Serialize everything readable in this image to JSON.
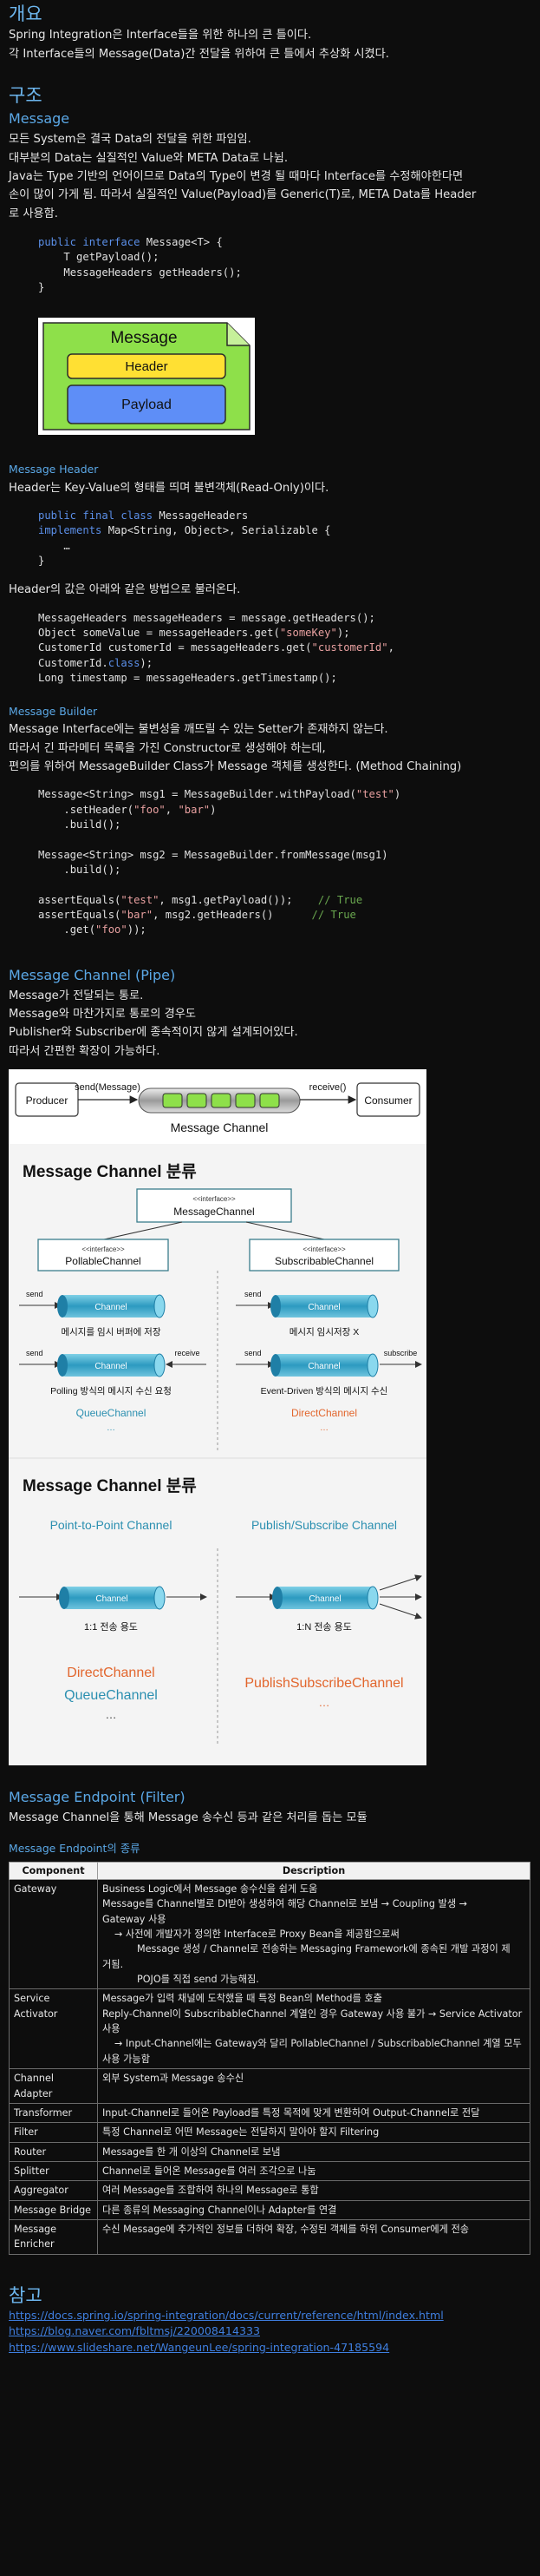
{
  "overview": {
    "title": "개요",
    "lines": [
      "Spring Integration은 Interface들을 위한 하나의 큰 틀이다.",
      "각 Interface들의 Message(Data)간 전달을 위하여 큰 틀에서 추상화 시켰다."
    ]
  },
  "structure": {
    "title": "구조",
    "message": {
      "title": "Message",
      "lines": [
        "모든 System은 결국 Data의 전달을 위한 파임임.",
        "대부분의 Data는 실질적인 Value와 META Data로 나뉨.",
        "Java는 Type 기반의 언어이므로 Data의 Type이 변경 될 때마다 Interface를 수정해야한다면",
        "손이 많이 가게 됨. 따라서 실질적인 Value(Payload)를 Generic(T)로, META Data를 Header",
        "로 사용함."
      ],
      "code": {
        "kw_public": "public",
        "kw_interface": "interface",
        "line1_rest": " Message<T> {",
        "line2": "T getPayload();",
        "line3": "MessageHeaders getHeaders();",
        "line4": "}"
      },
      "diagram": {
        "title": "Message",
        "header": "Header",
        "payload": "Payload",
        "colors": {
          "outer": "#8ee04a",
          "header": "#ffe033",
          "payload": "#5e8ef7"
        }
      }
    },
    "header": {
      "title": "Message Header",
      "line": "Header는 Key-Value의 형태를 띄며 불변객체(Read-Only)이다.",
      "code": {
        "kw_public": "public",
        "kw_final": "final",
        "kw_class": "class",
        "l1_rest": " MessageHeaders",
        "kw_implements": "implements",
        "l2_rest": " Map<String, Object>, Serializable {",
        "l3": "…",
        "l4": "}"
      },
      "line2": "Header의 값은 아래와 같은 방법으로 불러온다.",
      "code2": {
        "a1": "MessageHeaders messageHeaders = message.getHeaders();",
        "b1": "Object someValue = messageHeaders.get(",
        "b_str": "\"someKey\"",
        "b2": ");",
        "c1": "CustomerId customerId = messageHeaders.get(",
        "c_str": "\"customerId\"",
        "c2": ",",
        "d1": "CustomerId.",
        "d_kw": "class",
        "d2": ");",
        "e1": "Long timestamp = messageHeaders.getTimestamp();"
      }
    },
    "builder": {
      "title": "Message Builder",
      "lines": [
        "Message Interface에는 불변성을 깨뜨릴 수 있는 Setter가 존재하지 않는다.",
        "따라서 긴 파라메터 목록을 가진 Constructor로 생성해야 하는데,",
        "편의를 위하여 MessageBuilder Class가 Message 객체를 생성한다. (Method Chaining)"
      ],
      "code": {
        "a1": "Message<String> msg1 = MessageBuilder.withPayload(",
        "a_str": "\"test\"",
        "a2": ")",
        "b1": ".setHeader(",
        "b_s1": "\"foo\"",
        "b_mid": ", ",
        "b_s2": "\"bar\"",
        "b2": ")",
        "c1": ".build();",
        "d1": "Message<String> msg2 = MessageBuilder.fromMessage(msg1)",
        "e1": ".build();",
        "f1": "assertEquals(",
        "f_str": "\"test\"",
        "f2": ", msg1.getPayload());",
        "f_cmt": "// True",
        "g1": "assertEquals(",
        "g_str": "\"bar\"",
        "g2": ", msg2.getHeaders()",
        "g_cmt": "// True",
        "h1": ".get(",
        "h_str": "\"foo\"",
        "h2": "));"
      }
    },
    "channel": {
      "title": "Message Channel (Pipe)",
      "lines": [
        "Message가 전달되는 통로.",
        "Message와 마찬가지로 통로의 경우도",
        "Publisher와 Subscriber에 종속적이지 않게 설계되어있다.",
        "따라서 간편한 확장이 가능하다."
      ],
      "image": {
        "producer": "Producer",
        "send": "send(Message)",
        "receive": "receive()",
        "consumer": "Consumer",
        "pipe_caption": "Message Channel",
        "section1_title": "Message Channel 분류",
        "interface_tag": "<<interface>>",
        "top_box": "MessageChannel",
        "left_box": "PollableChannel",
        "right_box": "SubscribableChannel",
        "send_lbl": "send",
        "receive_lbl": "receive",
        "subscribe_lbl": "subscribe",
        "channel_lbl": "Channel",
        "l1_cap": "메시지를 임시 버퍼에 저장",
        "r1_cap": "메시지 임시저장 X",
        "l2_cap": "Polling 방식의 메시지 수신 요청",
        "r2_cap": "Event-Driven 방식의 메시지 수신",
        "l2_impl": "QueueChannel",
        "r2_impl": "DirectChannel",
        "dots": "…",
        "section2_title": "Message Channel 분류",
        "p2p": "Point-to-Point Channel",
        "pubsub": "Publish/Subscribe Channel",
        "p2p_cap": "1:1 전송 용도",
        "pubsub_cap": "1:N 전송 용도",
        "p2p_impl1": "DirectChannel",
        "p2p_impl2": "QueueChannel",
        "pubsub_impl": "PublishSubscribeChannel"
      }
    },
    "endpoint": {
      "title": "Message Endpoint (Filter)",
      "line": "Message Channel을 통해 Message 송수신 등과 같은 처리를 돕는 모듈",
      "kinds_title": "Message Endpoint의 종류",
      "table": {
        "headers": [
          "Component",
          "Description"
        ],
        "rows": [
          {
            "name": "Gateway",
            "desc": [
              {
                "t": "Business Logic에서 Message 송수신을 쉽게 도움",
                "i": 0
              },
              {
                "t": "Message를 Channel별로 DI받아 생성하여 해당 Channel로 보냄 → Coupling 발생 →",
                "i": 0
              },
              {
                "t": "Gateway 사용",
                "i": 0
              },
              {
                "t": "→ 사전에 개발자가 정의한 Interface로 Proxy Bean을 제공함으로써",
                "i": 1
              },
              {
                "t": "Message 생성 / Channel로 전송하는 Messaging Framework에 종속된 개발 과정이 제",
                "i": 2
              },
              {
                "t": "거됨.",
                "i": 0
              },
              {
                "t": "POJO를 직접 send 가능해짐.",
                "i": 2
              }
            ]
          },
          {
            "name": "Service Activator",
            "desc": [
              {
                "t": "Message가 입력 채널에 도착했을 때 특정 Bean의 Method를 호출",
                "i": 0
              },
              {
                "t": "Reply-Channel이 SubscribableChannel 계열인 경우 Gateway 사용 불가 → Service Activator",
                "i": 0
              },
              {
                "t": "사용",
                "i": 0
              },
              {
                "t": "→ Input-Channel에는 Gateway와 달리 PollableChannel / SubscribableChannel 계열 모두",
                "i": 1
              },
              {
                "t": "사용 가능함",
                "i": 0
              }
            ]
          },
          {
            "name": "Channel Adapter",
            "desc": [
              {
                "t": "외부 System과 Message 송수신",
                "i": 0
              }
            ]
          },
          {
            "name": "Transformer",
            "desc": [
              {
                "t": "Input-Channel로 들어온 Payload를 특정 목적에 맞게 변환하여 Output-Channel로 전달",
                "i": 0
              }
            ]
          },
          {
            "name": "Filter",
            "desc": [
              {
                "t": "특정 Channel로 어떤 Message는 전달하지 말아야 할지 Filtering",
                "i": 0
              }
            ]
          },
          {
            "name": "Router",
            "desc": [
              {
                "t": "Message를 한 개 이상의 Channel로 보냄",
                "i": 0
              }
            ]
          },
          {
            "name": "Splitter",
            "desc": [
              {
                "t": "Channel로 들어온 Message를 여러 조각으로 나눔",
                "i": 0
              }
            ]
          },
          {
            "name": "Aggregator",
            "desc": [
              {
                "t": "여러 Message를 조합하여 하나의 Message로 통합",
                "i": 0
              }
            ]
          },
          {
            "name": "Message Bridge",
            "desc": [
              {
                "t": "다른 종류의 Messaging Channel이나 Adapter를 연결",
                "i": 0
              }
            ]
          },
          {
            "name": "Message Enricher",
            "desc": [
              {
                "t": "수신 Message에 추가적인 정보를 더하여 확장, 수정된 객체를 하위 Consumer에게 전송",
                "i": 0
              }
            ]
          }
        ]
      }
    }
  },
  "references": {
    "title": "참고",
    "links": [
      "https://docs.spring.io/spring-integration/docs/current/reference/html/index.html",
      "https://blog.naver.com/fbltmsj/220008414333",
      "https://www.slideshare.net/WangeunLee/spring-integration-47185594"
    ]
  }
}
